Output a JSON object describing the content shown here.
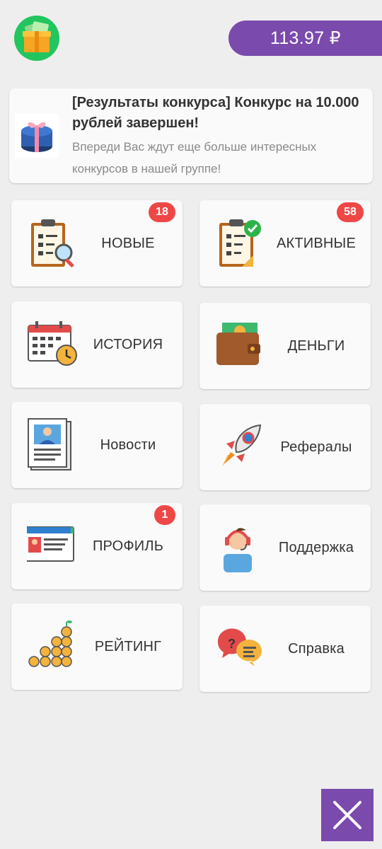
{
  "header": {
    "balance": "113.97 ₽",
    "logo_icon": "gift-box-money-icon"
  },
  "news": {
    "title": "[Результаты конкурса] Конкурс на 10.000 рублей завершен!",
    "body": "Впереди Вас ждут еще больше интересных конкурсов в нашей группе!",
    "icon": "gift-box-icon"
  },
  "tiles": [
    {
      "label": "НОВЫЕ",
      "badge": "18",
      "icon": "clipboard-search-icon"
    },
    {
      "label": "АКТИВНЫЕ",
      "badge": "58",
      "icon": "clipboard-check-icon"
    },
    {
      "label": "ИСТОРИЯ",
      "icon": "calendar-clock-icon"
    },
    {
      "label": "ДЕНЬГИ",
      "icon": "wallet-icon"
    },
    {
      "label": "Новости",
      "icon": "newspaper-icon"
    },
    {
      "label": "Рефералы",
      "icon": "rocket-icon"
    },
    {
      "label": "ПРОФИЛЬ",
      "badge": "1",
      "icon": "id-card-icon"
    },
    {
      "label": "Поддержка",
      "icon": "support-agent-icon"
    },
    {
      "label": "РЕЙТИНГ",
      "icon": "coin-stacks-icon"
    },
    {
      "label": "Справка",
      "icon": "chat-bubbles-icon"
    }
  ],
  "close_icon": "close-icon",
  "colors": {
    "accent": "#7a4aac",
    "badge": "#ef4646",
    "logo_bg": "#22c55e"
  }
}
